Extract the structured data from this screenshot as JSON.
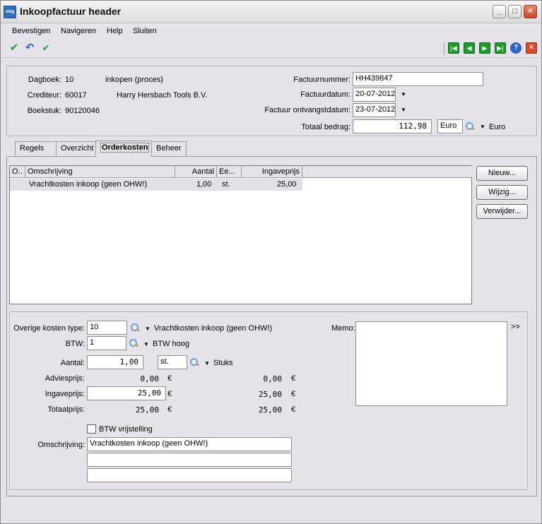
{
  "window": {
    "title": "Inkoopfactuur header",
    "app_icon_text": "mkg"
  },
  "menu": [
    "Bevestigen",
    "Navigeren",
    "Help",
    "Sluiten"
  ],
  "header": {
    "dagboek_label": "Dagboek:",
    "dagboek_value": "10",
    "dagboek_desc": "inkopen (proces)",
    "crediteur_label": "Crediteur:",
    "crediteur_value": "60017",
    "crediteur_desc": "Harry Hersbach Tools B.V.",
    "boekstuk_label": "Boekstuk:",
    "boekstuk_value": "90120046",
    "factuurnummer_label": "Factuurnummer:",
    "factuurnummer_value": "HH439847",
    "factuurdatum_label": "Factuurdatum:",
    "factuurdatum_value": "20-07-2012",
    "ontvangst_label": "Factuur ontvangstdatum:",
    "ontvangst_value": "23-07-2012",
    "totaal_label": "Totaal bedrag:",
    "totaal_value": "112,98",
    "valuta_code": "Euro",
    "valuta_desc": "Euro"
  },
  "tabs": [
    "Regels",
    "Overzicht",
    "Orderkosten",
    "Beheer"
  ],
  "active_tab": "Orderkosten",
  "grid": {
    "columns": [
      "O..",
      "Omschrijving",
      "Aantal",
      "Ee...",
      "Ingaveprijs"
    ],
    "rows": [
      {
        "omschrijving": "Vrachtkosten inkoop (geen OHW!)",
        "aantal": "1,00",
        "eenheid": "st.",
        "ingaveprijs": "25,00"
      }
    ]
  },
  "buttons": {
    "nieuw": "Nieuw...",
    "wijzig": "Wijzig...",
    "verwijder": "Verwijder..."
  },
  "detail": {
    "kosten_type_label": "Overige kosten type:",
    "kosten_type_value": "10",
    "kosten_type_desc": "Vrachtkosten inkoop (geen OHW!)",
    "btw_label": "BTW:",
    "btw_value": "1",
    "btw_desc": "BTW hoog",
    "aantal_label": "Aantal:",
    "aantal_value": "1,00",
    "eenheid_value": "st.",
    "eenheid_desc": "Stuks",
    "adviesprijs_label": "Adviesprijs:",
    "adviesprijs_value": "0,00",
    "adviesprijs_value2": "0,00",
    "ingaveprijs_label": "Ingaveprijs:",
    "ingaveprijs_value": "25,00",
    "ingaveprijs_value2": "25,00",
    "totaalprijs_label": "Totaalprijs:",
    "totaalprijs_value": "25,00",
    "totaalprijs_value2": "25,00",
    "currency_symbol": "€",
    "btw_vrijstelling_label": "BTW vrijstelling",
    "omschrijving_label": "Omschrijving:",
    "omschrijving_value": "Vrachtkosten inkoop (geen OHW!)",
    "omschrijving_line2": "",
    "omschrijving_line3": "",
    "memo_label": "Memo:",
    "memo_expand": ">>"
  },
  "colors": {
    "accent_green": "#1f9a2c",
    "close_red": "#d64a2e",
    "help_blue": "#2a63c8"
  }
}
